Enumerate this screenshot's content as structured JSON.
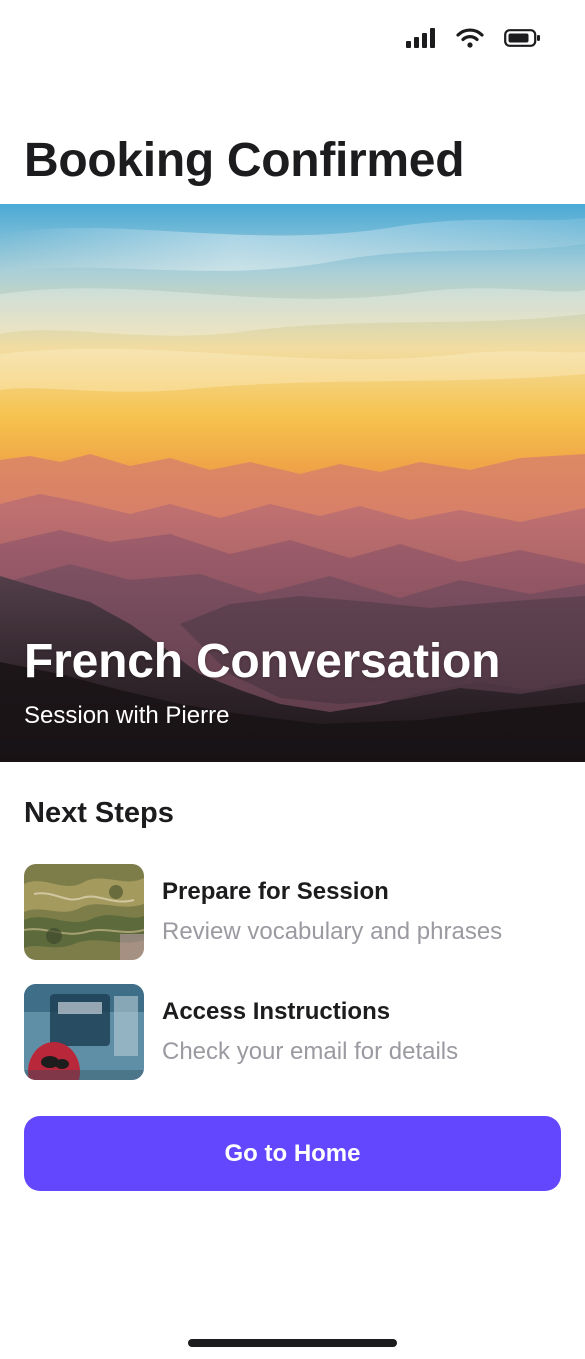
{
  "status_bar": {
    "icons": [
      "cellular-signal-icon",
      "wifi-icon",
      "battery-icon"
    ]
  },
  "page": {
    "title": "Booking Confirmed"
  },
  "hero": {
    "image": "mountain-sunset-image",
    "title": "French Conversation",
    "subtitle": "Session with Pierre"
  },
  "next_steps": {
    "heading": "Next Steps",
    "items": [
      {
        "title": "Prepare for Session",
        "description": "Review vocabulary and phrases",
        "thumbnail": "aerial-landscape-image"
      },
      {
        "title": "Access Instructions",
        "description": "Check your email for details",
        "thumbnail": "figure-with-sign-image"
      }
    ]
  },
  "actions": {
    "home_label": "Go to Home"
  },
  "colors": {
    "accent": "#6347ff",
    "text_primary": "#1c1c1e",
    "text_secondary": "#9a9aa1",
    "background": "#ffffff"
  }
}
